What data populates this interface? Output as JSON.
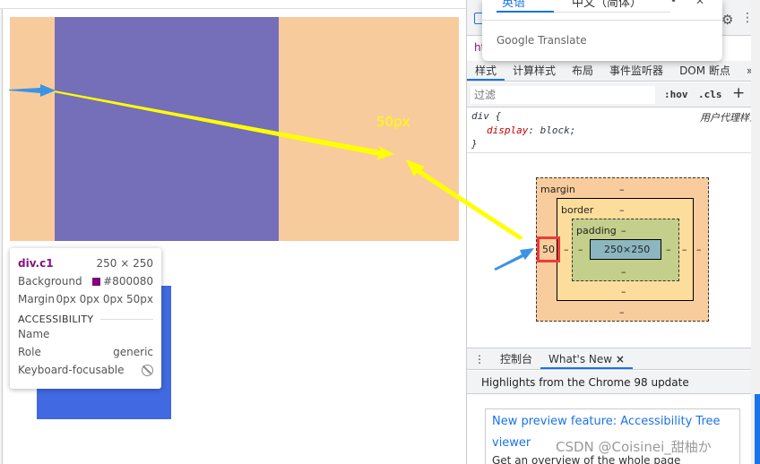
{
  "tooltip": {
    "selector": "div.c1",
    "size": "250 × 250",
    "background_label": "Background",
    "background_value": "#800080",
    "margin_label": "Margin",
    "margin_value": "0px 0px 0px 50px",
    "accessibility_heading": "ACCESSIBILITY",
    "name_label": "Name",
    "role_label": "Role",
    "role_value": "generic",
    "focusable_label": "Keyboard-focusable",
    "focusable_icon": "not-allowed-icon"
  },
  "annotation": {
    "label": "50px",
    "arrow_color": "#ffff00",
    "pointer_color": "#3b93e6"
  },
  "colors": {
    "margin": "#f8cb9c",
    "content": "#756eb9",
    "blue_box": "#4169e1",
    "background_swatch": "#800080"
  },
  "translate": {
    "tab1": "英语",
    "tab2": "中文（简体）",
    "brand": "Google Translate"
  },
  "elements_line": "ht",
  "panel_tabs": [
    "样式",
    "计算样式",
    "布局",
    "事件监听器",
    "DOM 断点",
    "»"
  ],
  "filter": {
    "placeholder": "过滤",
    "hov": ":hov",
    "cls": ".cls",
    "add": "+"
  },
  "rule": {
    "selector": "div {",
    "source": "用户代理样式表",
    "property": "display",
    "value": "block;",
    "close": "}"
  },
  "box_model": {
    "margin_label": "margin",
    "border_label": "border",
    "padding_label": "padding",
    "content": "250×250",
    "margin_left": "50",
    "dash": "–"
  },
  "drawer": {
    "tab1": "控制台",
    "tab2": "What's New",
    "close": "×",
    "highlights": "Highlights from the Chrome 98 update",
    "card_title": "New preview feature: Accessibility Tree viewer",
    "card_body": "Get an overview of the whole page"
  },
  "watermark": "CSDN @Coisinei_甜柚か"
}
